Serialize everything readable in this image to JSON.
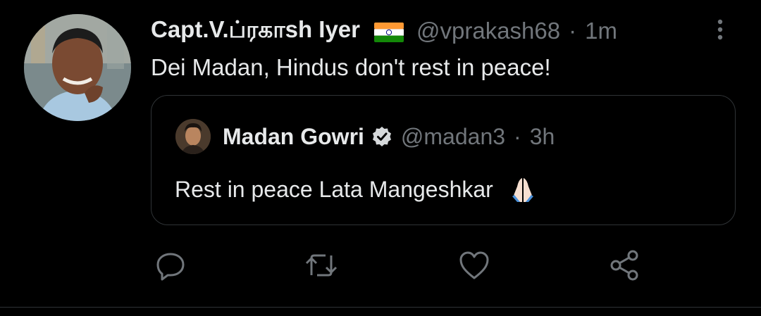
{
  "tweet": {
    "author_name": "Capt.V.பிரகாஷ் Iyer",
    "author_name_display": "Capt.V.ப்ரகாsh Iyer",
    "flag_icon": "india-flag-icon",
    "handle": "@vprakash68",
    "separator": "·",
    "time": "1m",
    "text": "Dei Madan, Hindus don't rest in peace!"
  },
  "quoted_tweet": {
    "author_name": "Madan Gowri",
    "verified_icon": "verified-badge-icon",
    "handle": "@madan3",
    "separator": "·",
    "time": "3h",
    "text": "Rest in peace Lata Mangeshkar",
    "emoji_icon": "folded-hands-emoji"
  },
  "actions": [
    {
      "name": "reply",
      "icon": "reply-icon"
    },
    {
      "name": "retweet",
      "icon": "retweet-icon"
    },
    {
      "name": "like",
      "icon": "heart-icon"
    },
    {
      "name": "share",
      "icon": "share-icon"
    }
  ],
  "colors": {
    "background": "#000000",
    "primary_text": "#e7e9ea",
    "secondary_text": "#71767b",
    "border": "#2f3336"
  }
}
